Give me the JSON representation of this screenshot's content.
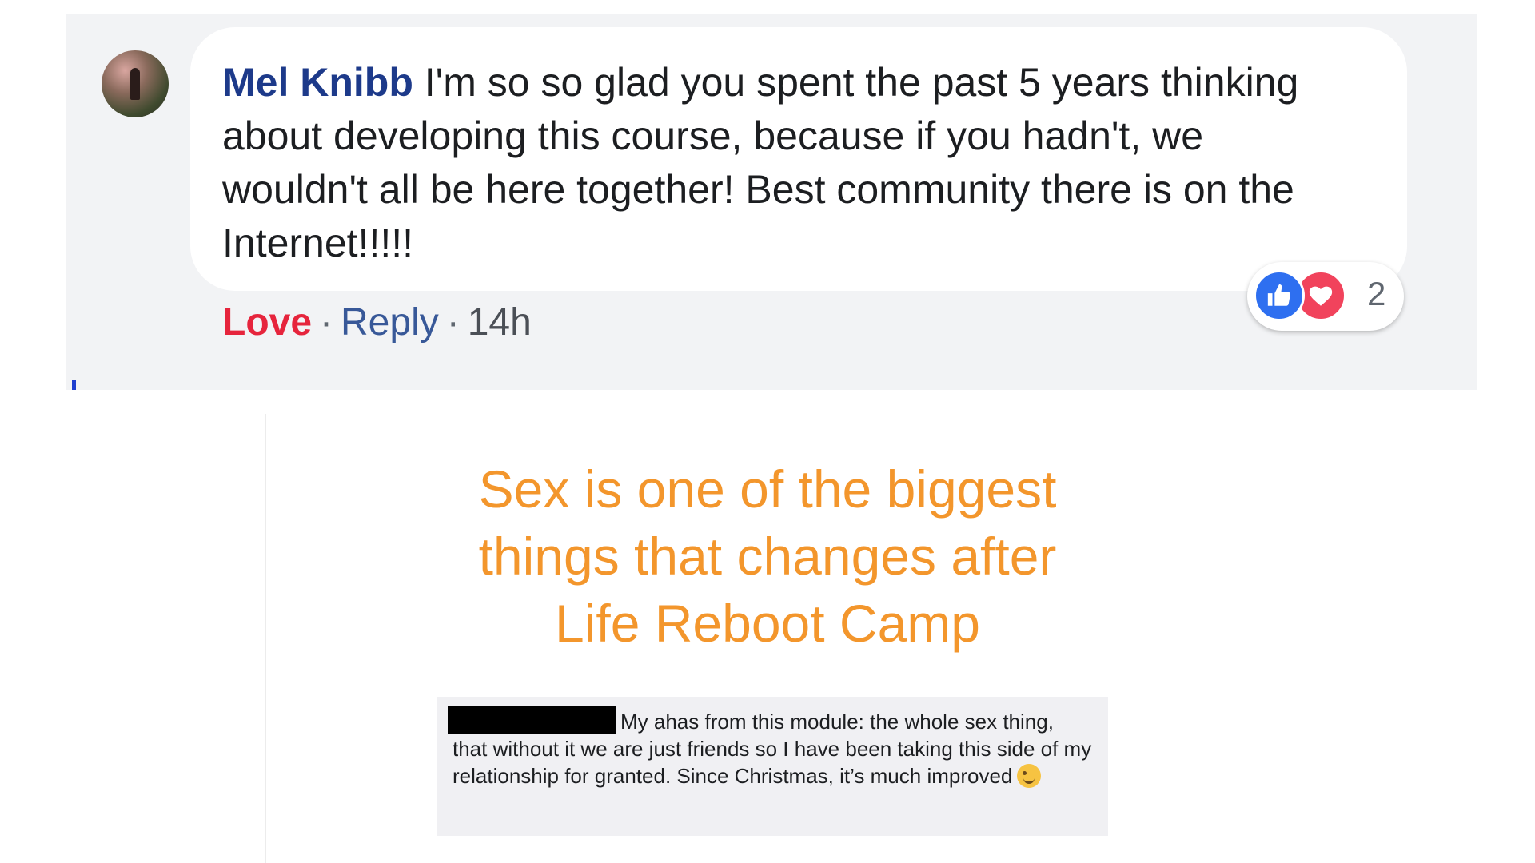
{
  "comment": {
    "author": "Mel Knibb",
    "text": "I'm so so glad you spent the past 5 years thinking about developing this course, because if you hadn't, we wouldn't all be here together! Best community there is on the Internet!!!!!",
    "reaction_count": "2",
    "actions": {
      "love": "Love",
      "reply": "Reply",
      "time": "14h"
    },
    "reaction_icons": [
      "like-icon",
      "heart-icon"
    ]
  },
  "promo": {
    "headline_lines": [
      "Sex is one of the biggest",
      "things that changes after",
      "Life Reboot Camp"
    ],
    "testimonial": {
      "text": "My ahas from this module: the whole sex thing, that without it we are just friends so I have been taking this side of my relationship for granted. Since Christmas, it’s much improved"
    }
  },
  "colors": {
    "panel_bg": "#f2f3f5",
    "author": "#1d3a8a",
    "love": "#e6243c",
    "link": "#385898",
    "headline": "#f3962c",
    "like": "#2e6ff0",
    "heart": "#f1435c"
  }
}
